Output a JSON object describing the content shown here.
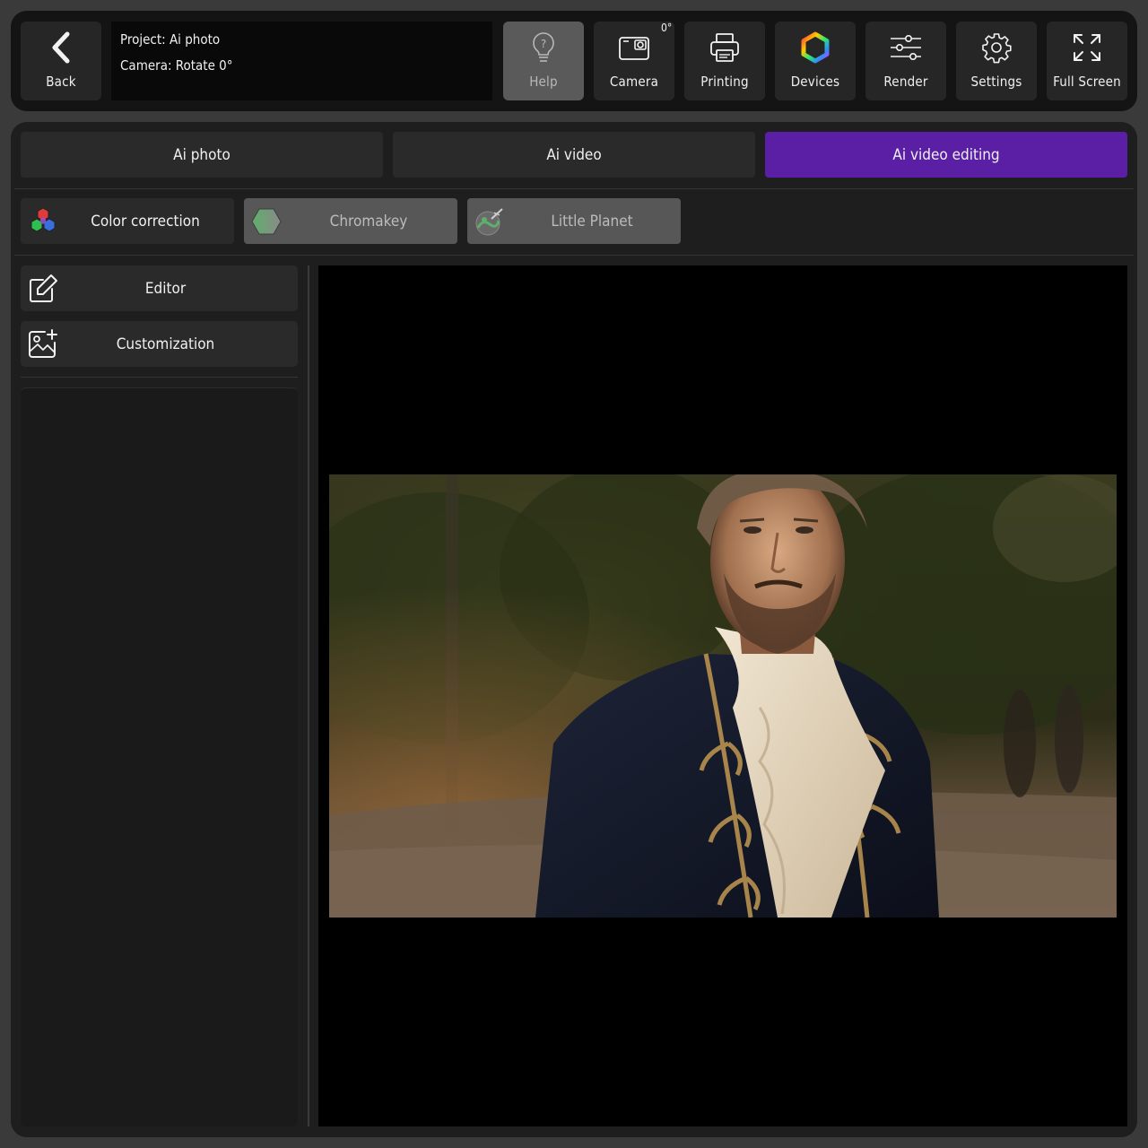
{
  "topbar": {
    "back_label": "Back",
    "project_line": "Project: Ai photo",
    "camera_line": "Camera: Rotate 0°",
    "camera_rotation_badge": "0°",
    "buttons": {
      "help": "Help",
      "camera": "Camera",
      "printing": "Printing",
      "devices": "Devices",
      "render": "Render",
      "settings": "Settings",
      "fullscreen": "Full Screen"
    }
  },
  "tabs": [
    {
      "label": "Ai photo",
      "active": false
    },
    {
      "label": "Ai video",
      "active": false
    },
    {
      "label": "Ai video editing",
      "active": true
    }
  ],
  "tools": [
    {
      "label": "Color correction",
      "enabled": true,
      "icon": "color-correction-icon"
    },
    {
      "label": "Chromakey",
      "enabled": false,
      "icon": "chromakey-icon"
    },
    {
      "label": "Little Planet",
      "enabled": false,
      "icon": "little-planet-icon"
    }
  ],
  "sidebar": {
    "editor_label": "Editor",
    "customization_label": "Customization"
  },
  "colors": {
    "accent": "#5b1fa6",
    "panel": "#1e1e1e",
    "button": "#2a2a2a",
    "disabled": "#575757"
  }
}
